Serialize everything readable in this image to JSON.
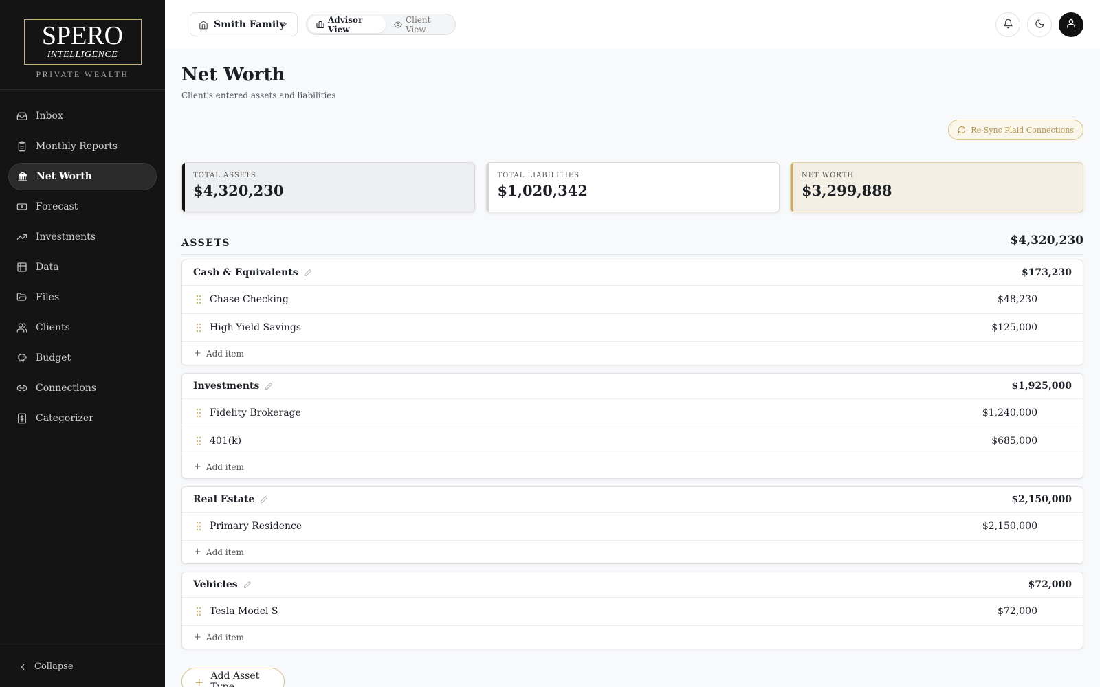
{
  "brand": {
    "name": "SPERO",
    "sub": "INTELLIGENCE",
    "tagline": "PRIVATE WEALTH",
    "accent": "#c9b37a"
  },
  "sidebar": {
    "items": [
      {
        "label": "Inbox",
        "icon": "inbox-icon",
        "active": false
      },
      {
        "label": "Monthly Reports",
        "icon": "clipboard-icon",
        "active": false
      },
      {
        "label": "Net Worth",
        "icon": "bank-icon",
        "active": true
      },
      {
        "label": "Forecast",
        "icon": "banknote-icon",
        "active": false
      },
      {
        "label": "Investments",
        "icon": "trending-up-icon",
        "active": false
      },
      {
        "label": "Data",
        "icon": "table-icon",
        "active": false
      },
      {
        "label": "Files",
        "icon": "folder-open-icon",
        "active": false
      },
      {
        "label": "Clients",
        "icon": "users-icon",
        "active": false
      },
      {
        "label": "Budget",
        "icon": "piggy-bank-icon",
        "active": false
      },
      {
        "label": "Connections",
        "icon": "link-icon",
        "active": false
      },
      {
        "label": "Categorizer",
        "icon": "receipt-icon",
        "active": false
      }
    ],
    "collapse_label": "Collapse"
  },
  "header": {
    "family": "Smith Family",
    "advisor_view": "Advisor View",
    "client_view": "Client View"
  },
  "page": {
    "title": "Net Worth",
    "subtitle": "Client's entered assets and liabilities",
    "resync_label": "Re-Sync Plaid Connections"
  },
  "summary": {
    "assets_label": "TOTAL ASSETS",
    "assets_value": "$4,320,230",
    "liabilities_label": "TOTAL LIABILITIES",
    "liabilities_value": "$1,020,342",
    "networth_label": "NET WORTH",
    "networth_value": "$3,299,888"
  },
  "assets": {
    "title": "ASSETS",
    "total": "$4,320,230",
    "add_item_label": "Add item",
    "add_type_label": "Add Asset Type",
    "groups": [
      {
        "name": "Cash & Equivalents",
        "total": "$173,230",
        "items": [
          {
            "name": "Chase Checking",
            "value": "$48,230"
          },
          {
            "name": "High-Yield Savings",
            "value": "$125,000"
          }
        ]
      },
      {
        "name": "Investments",
        "total": "$1,925,000",
        "items": [
          {
            "name": "Fidelity Brokerage",
            "value": "$1,240,000"
          },
          {
            "name": "401(k)",
            "value": "$685,000"
          }
        ]
      },
      {
        "name": "Real Estate",
        "total": "$2,150,000",
        "items": [
          {
            "name": "Primary Residence",
            "value": "$2,150,000"
          }
        ]
      },
      {
        "name": "Vehicles",
        "total": "$72,000",
        "items": [
          {
            "name": "Tesla Model S",
            "value": "$72,000"
          }
        ]
      }
    ]
  }
}
